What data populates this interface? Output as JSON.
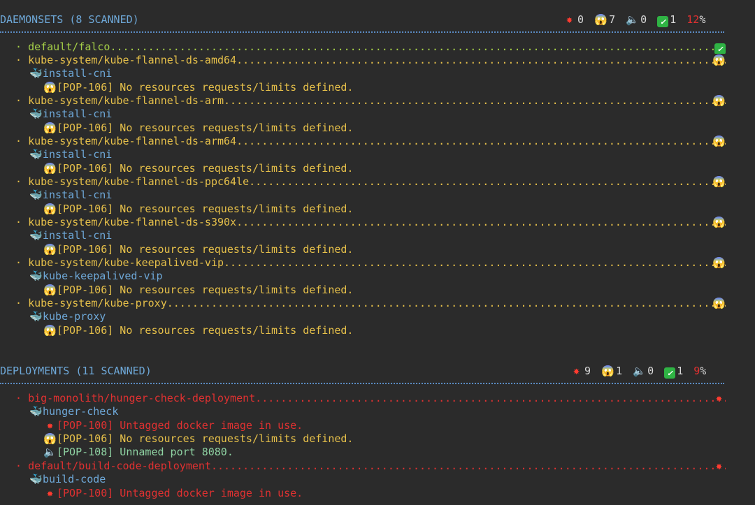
{
  "colors": {
    "background": "#2b2b2b",
    "header_text": "#6ea8d8",
    "ok": "#a6d048",
    "warn": "#e6c04a",
    "error": "#e03131",
    "info": "#8fd3a3",
    "container": "#6ea8d8",
    "rule": "#5b8cc4"
  },
  "icons": {
    "error": "✸",
    "warn": "😱",
    "info": "🔈",
    "ok": "✓",
    "container": "🐳",
    "bullet": "·"
  },
  "daemonsets": {
    "title": "DAEMONSETS (8 SCANNED)",
    "stats": {
      "errors": "0",
      "warnings": "7",
      "infos": "0",
      "ok": "1",
      "score": "12",
      "pct": "%"
    },
    "rows": [
      {
        "name": "default/falco",
        "dots": "............................................................................................................................",
        "status": "ok"
      },
      {
        "name": "kube-system/kube-flannel-ds-amd64",
        "dots": "................................................................................................",
        "status": "warn"
      },
      {
        "name": "kube-system/kube-flannel-ds-arm",
        "dots": "..................................................................................................",
        "status": "warn"
      },
      {
        "name": "kube-system/kube-flannel-ds-arm64",
        "dots": "................................................................................................",
        "status": "warn"
      },
      {
        "name": "kube-system/kube-flannel-ds-ppc64le",
        "dots": "..............................................................................................",
        "status": "warn"
      },
      {
        "name": "kube-system/kube-flannel-ds-s390x",
        "dots": "................................................................................................",
        "status": "warn"
      },
      {
        "name": "kube-system/kube-keepalived-vip",
        "dots": "..................................................................................................",
        "status": "warn"
      },
      {
        "name": "kube-system/kube-proxy",
        "dots": "...........................................................................................................",
        "status": "warn"
      }
    ],
    "containers": [
      "install-cni",
      "install-cni",
      "install-cni",
      "install-cni",
      "install-cni",
      "kube-keepalived-vip",
      "kube-proxy"
    ],
    "issue": "[POP-106] No resources requests/limits defined."
  },
  "deployments": {
    "title": "DEPLOYMENTS (11 SCANNED)",
    "stats": {
      "errors": "9",
      "warnings": "1",
      "infos": "0",
      "ok": "1",
      "score": "9",
      "pct": "%"
    },
    "rows": [
      {
        "name": "big-monolith/hunger-check-deployment",
        "dots": "...............................................................................................",
        "status": "error"
      },
      {
        "name": "default/build-code-deployment",
        "dots": "............................................................................................................",
        "status": "error"
      }
    ],
    "containers": [
      "hunger-check",
      "build-code"
    ],
    "issues": {
      "untagged": "[POP-100] Untagged docker image in use.",
      "no_resources": "[POP-106] No resources requests/limits defined.",
      "unnamed_port": "[POP-108] Unnamed port 8080."
    }
  }
}
